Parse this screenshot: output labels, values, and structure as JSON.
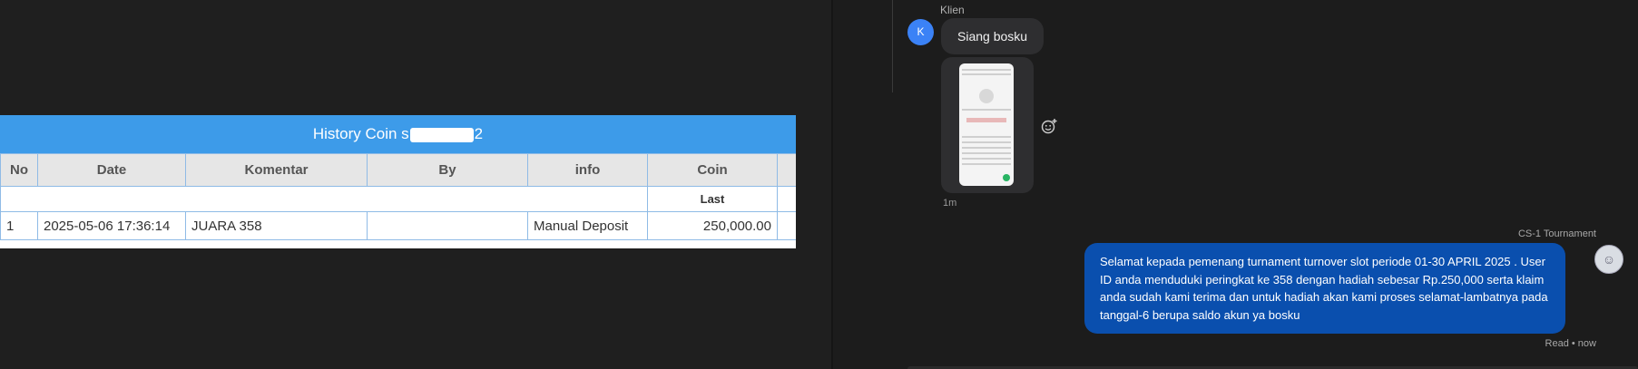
{
  "history": {
    "title_prefix": "History Coin s",
    "title_suffix": "2",
    "columns": [
      "No",
      "Date",
      "Komentar",
      "By",
      "info",
      "Coin"
    ],
    "subheader_last": "Last",
    "rows": [
      {
        "no": "1",
        "date": "2025-05-06 17:36:14",
        "komentar": "JUARA 358",
        "by": "",
        "info": "Manual Deposit",
        "coin": "250,000.00"
      }
    ]
  },
  "chat": {
    "incoming": {
      "sender": "Klien",
      "avatar_letter": "K",
      "message": "Siang bosku",
      "image_time": "1m"
    },
    "outgoing": {
      "sender": "CS-1 Tournament",
      "message": "Selamat kepada pemenang turnament turnover slot periode 01-30 APRIL 2025 . User ID anda menduduki peringkat ke 358 dengan hadiah sebesar Rp.250,000 serta klaim anda sudah kami terima dan untuk hadiah akan kami proses selamat-lambatnya pada tanggal-6 berupa saldo akun ya bosku",
      "status": "Read • now"
    },
    "colors": {
      "incoming_bubble": "#2e2e30",
      "outgoing_bubble": "#0a4fae",
      "avatar": "#3b82f6"
    }
  }
}
